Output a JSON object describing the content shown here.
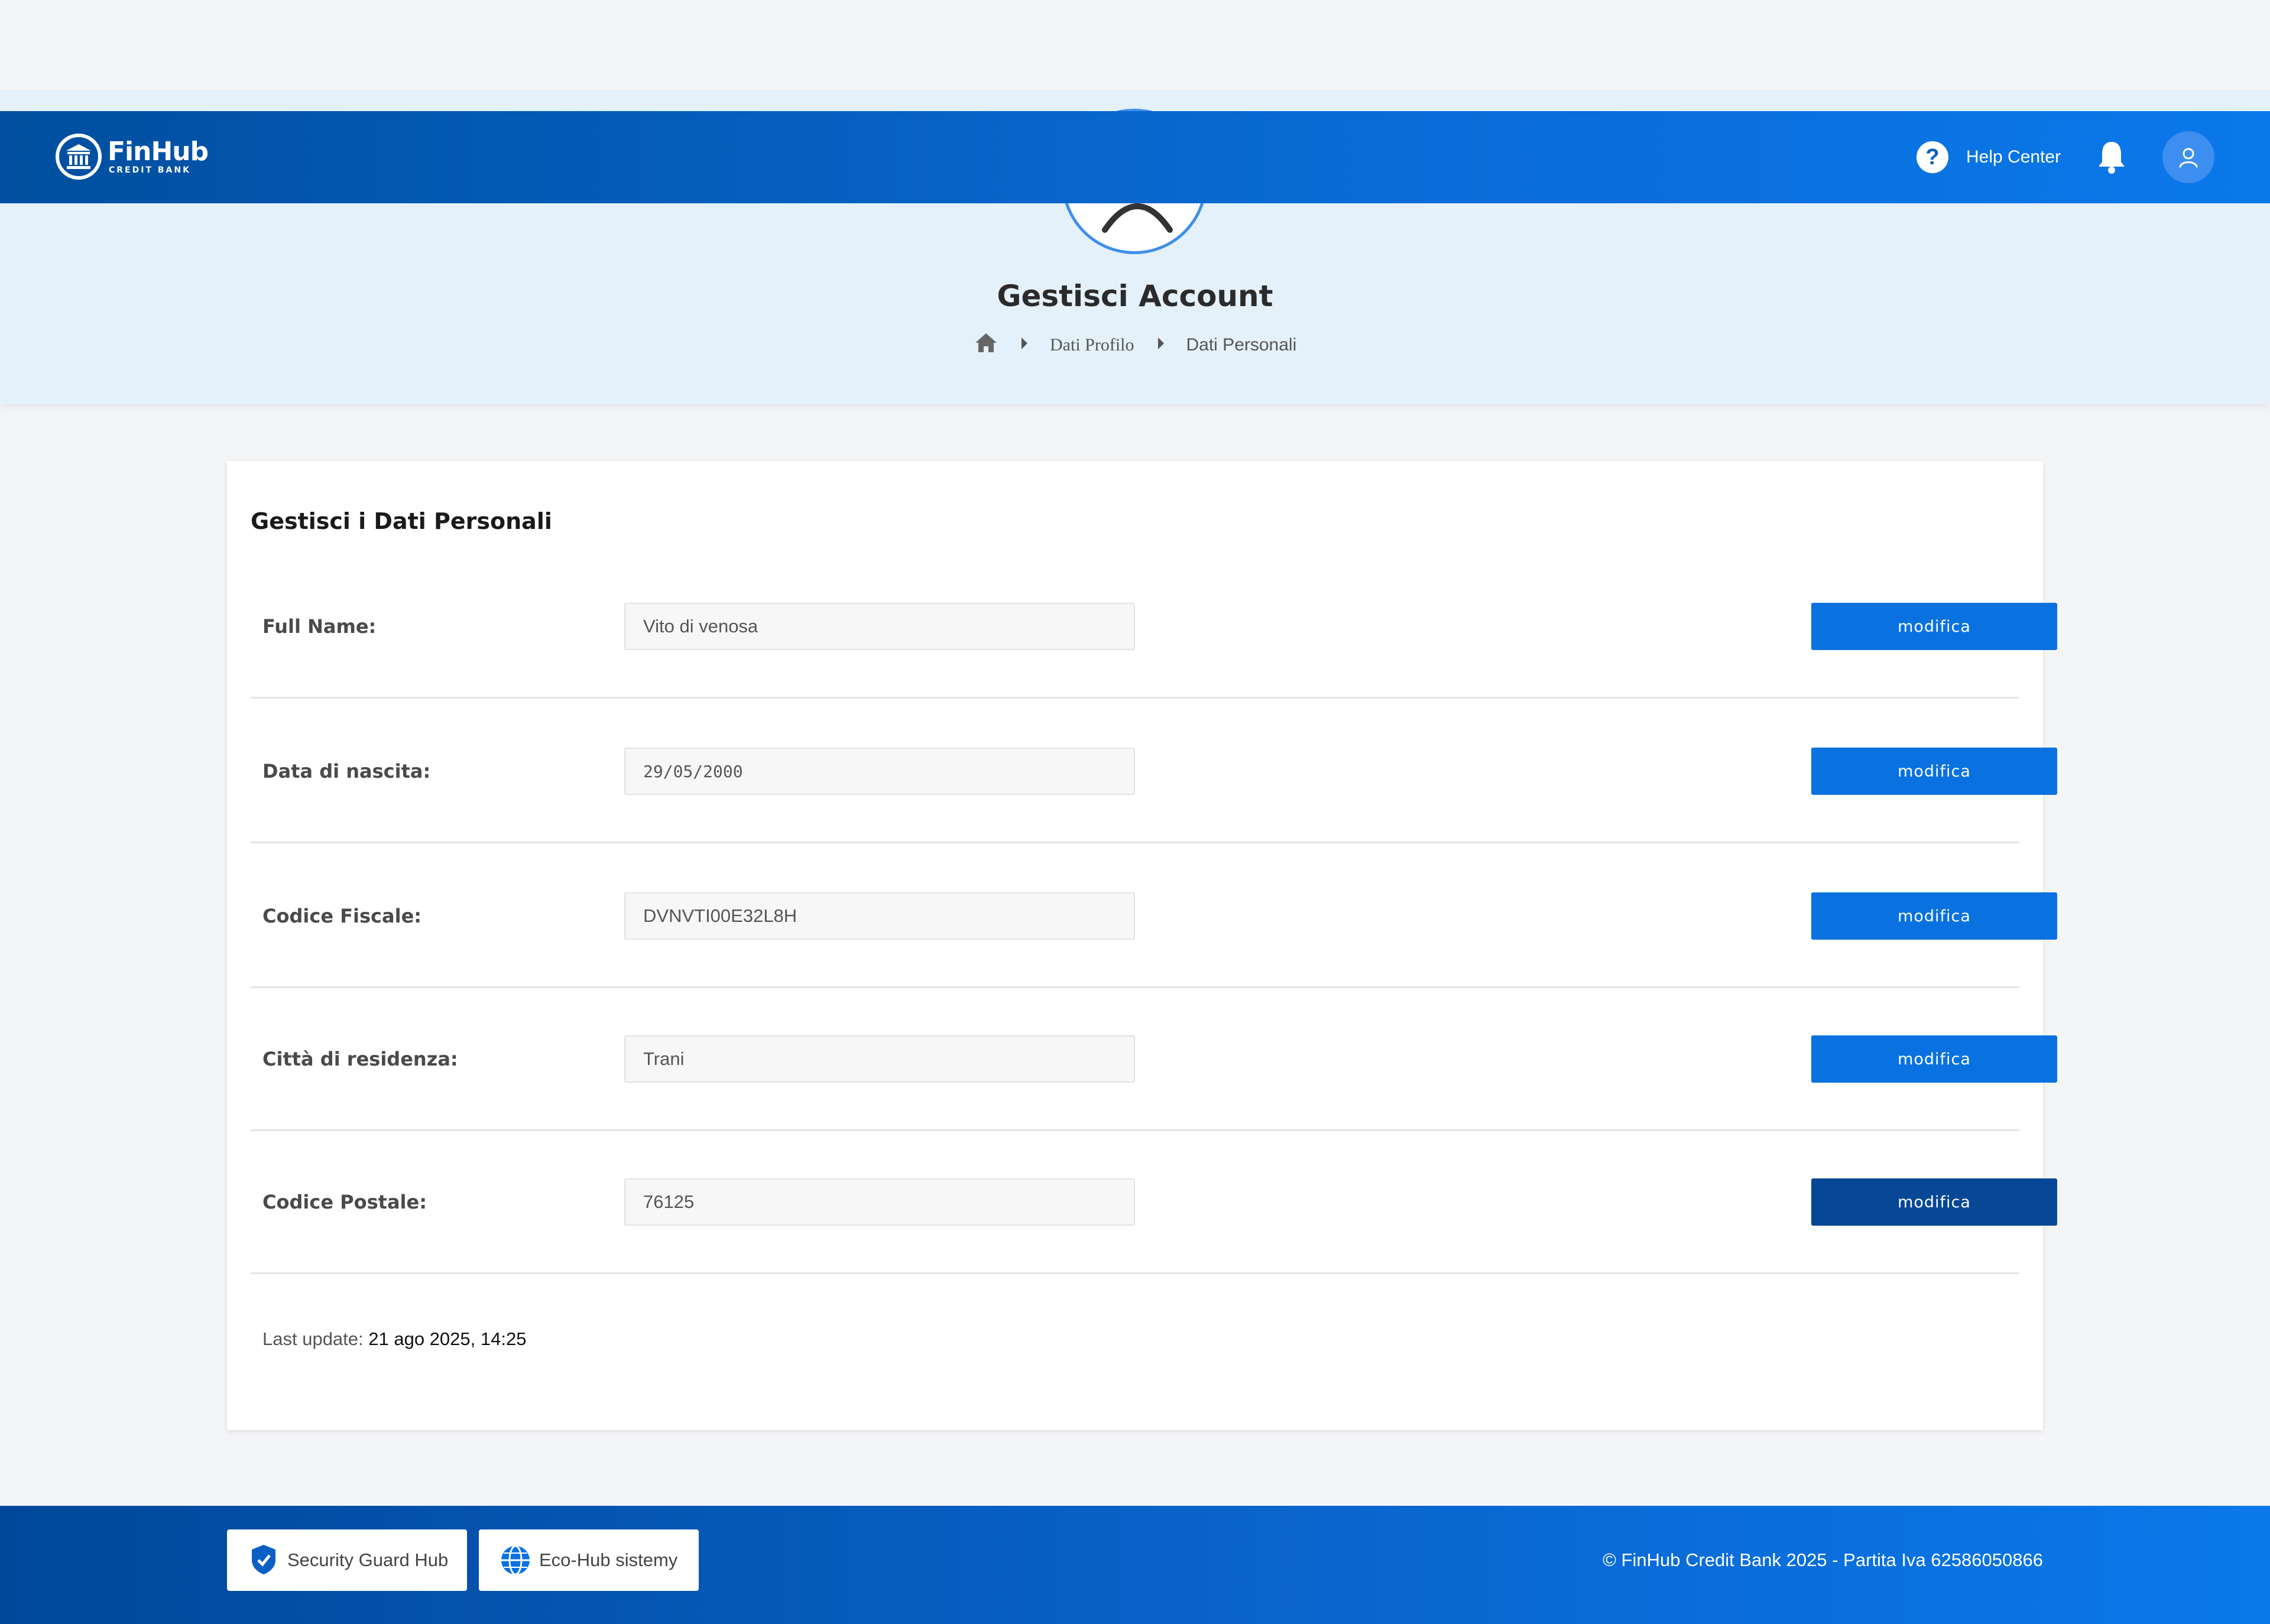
{
  "header": {
    "logo_title": "FinHub",
    "logo_subtitle": "CREDIT BANK",
    "help_label": "Help Center",
    "icons": [
      "bank-icon",
      "help-icon",
      "bell-icon",
      "user-icon"
    ]
  },
  "hero": {
    "title": "Gestisci Account",
    "breadcrumb": [
      "Dati Profilo",
      "Dati Personali"
    ]
  },
  "card": {
    "title": "Gestisci i Dati Personali",
    "rows": [
      {
        "label": "Full Name:",
        "value": "Vito di venosa",
        "button": "modifica"
      },
      {
        "label": "Data di nascita:",
        "value": "29/05/2000",
        "button": "modifica"
      },
      {
        "label": "Codice Fiscale:",
        "value": "DVNVTI00E32L8H",
        "button": "modifica"
      },
      {
        "label": "Città di residenza:",
        "value": "Trani",
        "button": "modifica"
      },
      {
        "label": "Codice Postale:",
        "value": "76125",
        "button": "modifica"
      }
    ],
    "last_update_label": "Last update:",
    "last_update_value": "21 ago 2025, 14:25"
  },
  "footer": {
    "badge1": "Security Guard Hub",
    "badge2": "Eco-Hub sistemy",
    "copyright": "© FinHub Credit Bank 2025 - Partita Iva 62586050866"
  },
  "colors": {
    "header_start": "#004f9f",
    "header_end": "#0a78ea",
    "button": "#0a72e0",
    "button_active": "#064896",
    "hero_bg": "#e4f1fb"
  }
}
